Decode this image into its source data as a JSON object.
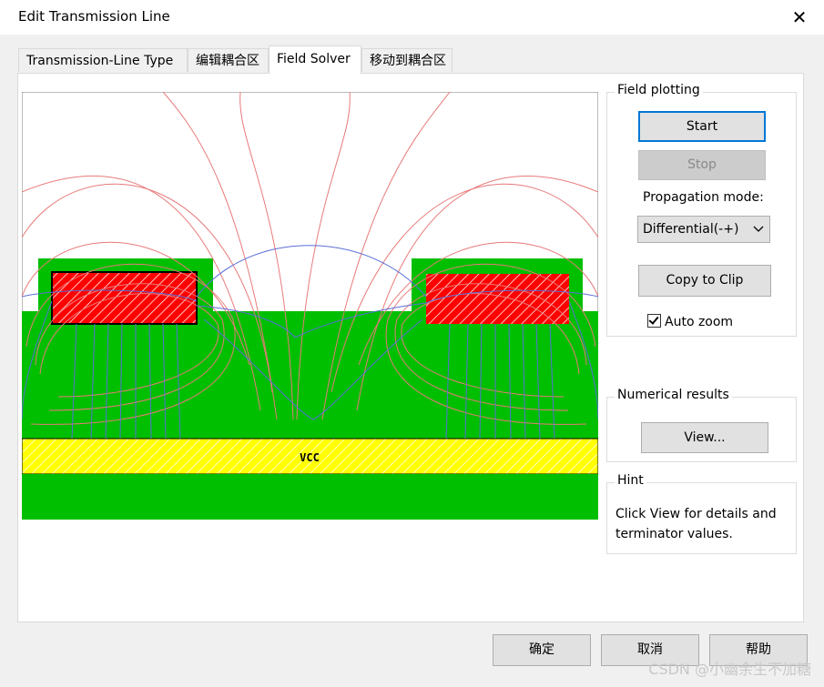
{
  "window": {
    "title": "Edit Transmission Line",
    "close_glyph": "✕"
  },
  "tabs": [
    {
      "label": "Transmission-Line Type"
    },
    {
      "label": "编辑耦合区"
    },
    {
      "label": "Field Solver"
    },
    {
      "label": "移动到耦合区"
    }
  ],
  "canvas": {
    "layer_label": "VCC"
  },
  "field_plotting": {
    "title": "Field plotting",
    "start_label": "Start",
    "stop_label": "Stop",
    "propagation_label": "Propagation mode:",
    "mode_value": "Differential(-+)",
    "copy_label": "Copy to Clip",
    "auto_zoom_label": "Auto zoom"
  },
  "numerical": {
    "title": "Numerical results",
    "view_label": "View..."
  },
  "hint": {
    "title": "Hint",
    "line1": "Click View for details and",
    "line2": "terminator values."
  },
  "footer": {
    "ok_label": "确定",
    "cancel_label": "取消",
    "help_label": "帮助"
  },
  "watermark": "CSDN @小幽余生不加糖",
  "colors": {
    "substrate": "#00bf00",
    "trace": "#ff0000",
    "plane": "#ffff00",
    "field_red": "#e87a7a",
    "field_blue": "#5a6fd8",
    "focus": "#0078d7"
  }
}
